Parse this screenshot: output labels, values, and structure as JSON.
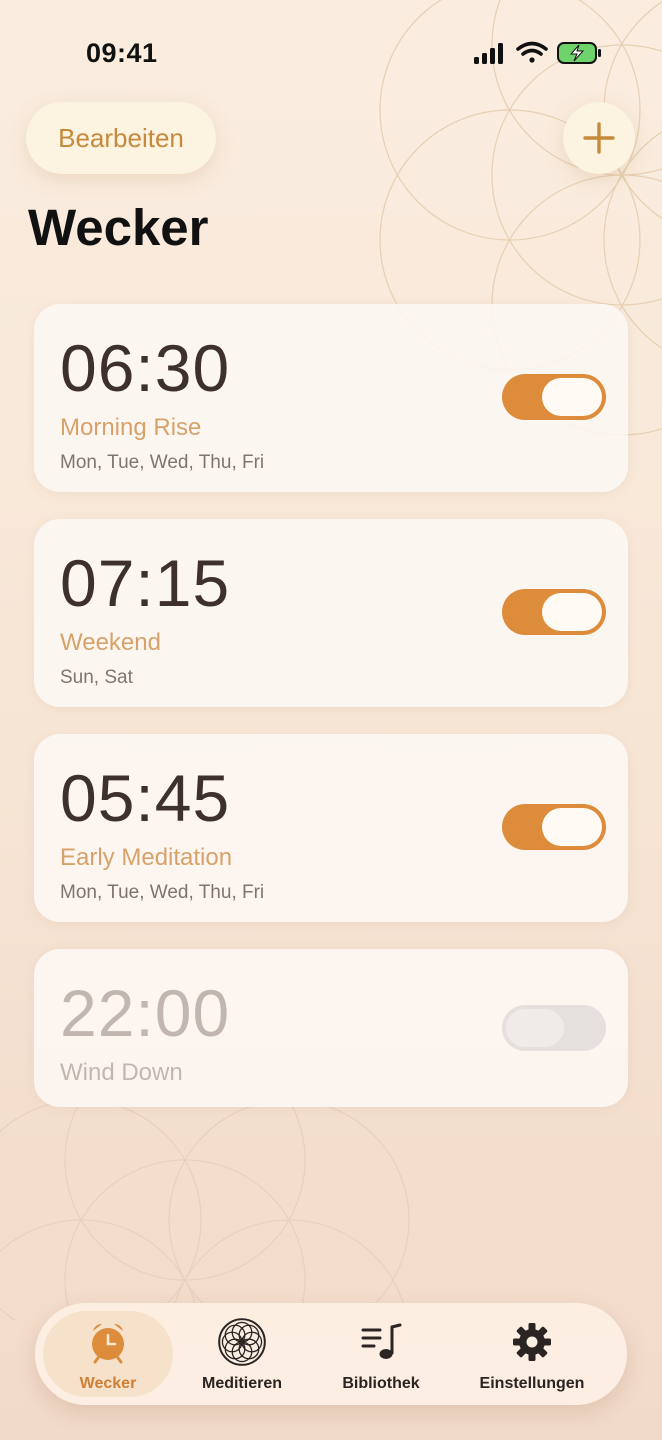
{
  "status_bar": {
    "time": "09:41"
  },
  "header": {
    "edit_label": "Bearbeiten",
    "title": "Wecker"
  },
  "alarms": [
    {
      "time": "06:30",
      "label": "Morning Rise",
      "days": "Mon, Tue, Wed, Thu, Fri",
      "enabled": true
    },
    {
      "time": "07:15",
      "label": "Weekend",
      "days": "Sun, Sat",
      "enabled": true
    },
    {
      "time": "05:45",
      "label": "Early Meditation",
      "days": "Mon, Tue, Wed, Thu, Fri",
      "enabled": true
    },
    {
      "time": "22:00",
      "label": "Wind Down",
      "days": "",
      "enabled": false
    }
  ],
  "tabs": [
    {
      "label": "Wecker",
      "icon": "alarm-clock-icon",
      "active": true
    },
    {
      "label": "Meditieren",
      "icon": "mandala-icon",
      "active": false
    },
    {
      "label": "Bibliothek",
      "icon": "music-library-icon",
      "active": false
    },
    {
      "label": "Einstellungen",
      "icon": "gear-icon",
      "active": false
    }
  ],
  "colors": {
    "accent": "#dd8c3c",
    "accent_text": "#c68a3c",
    "label_text": "#d6a26a",
    "background": "#f7e6d6",
    "toggle_off": "#e5e0dd"
  }
}
